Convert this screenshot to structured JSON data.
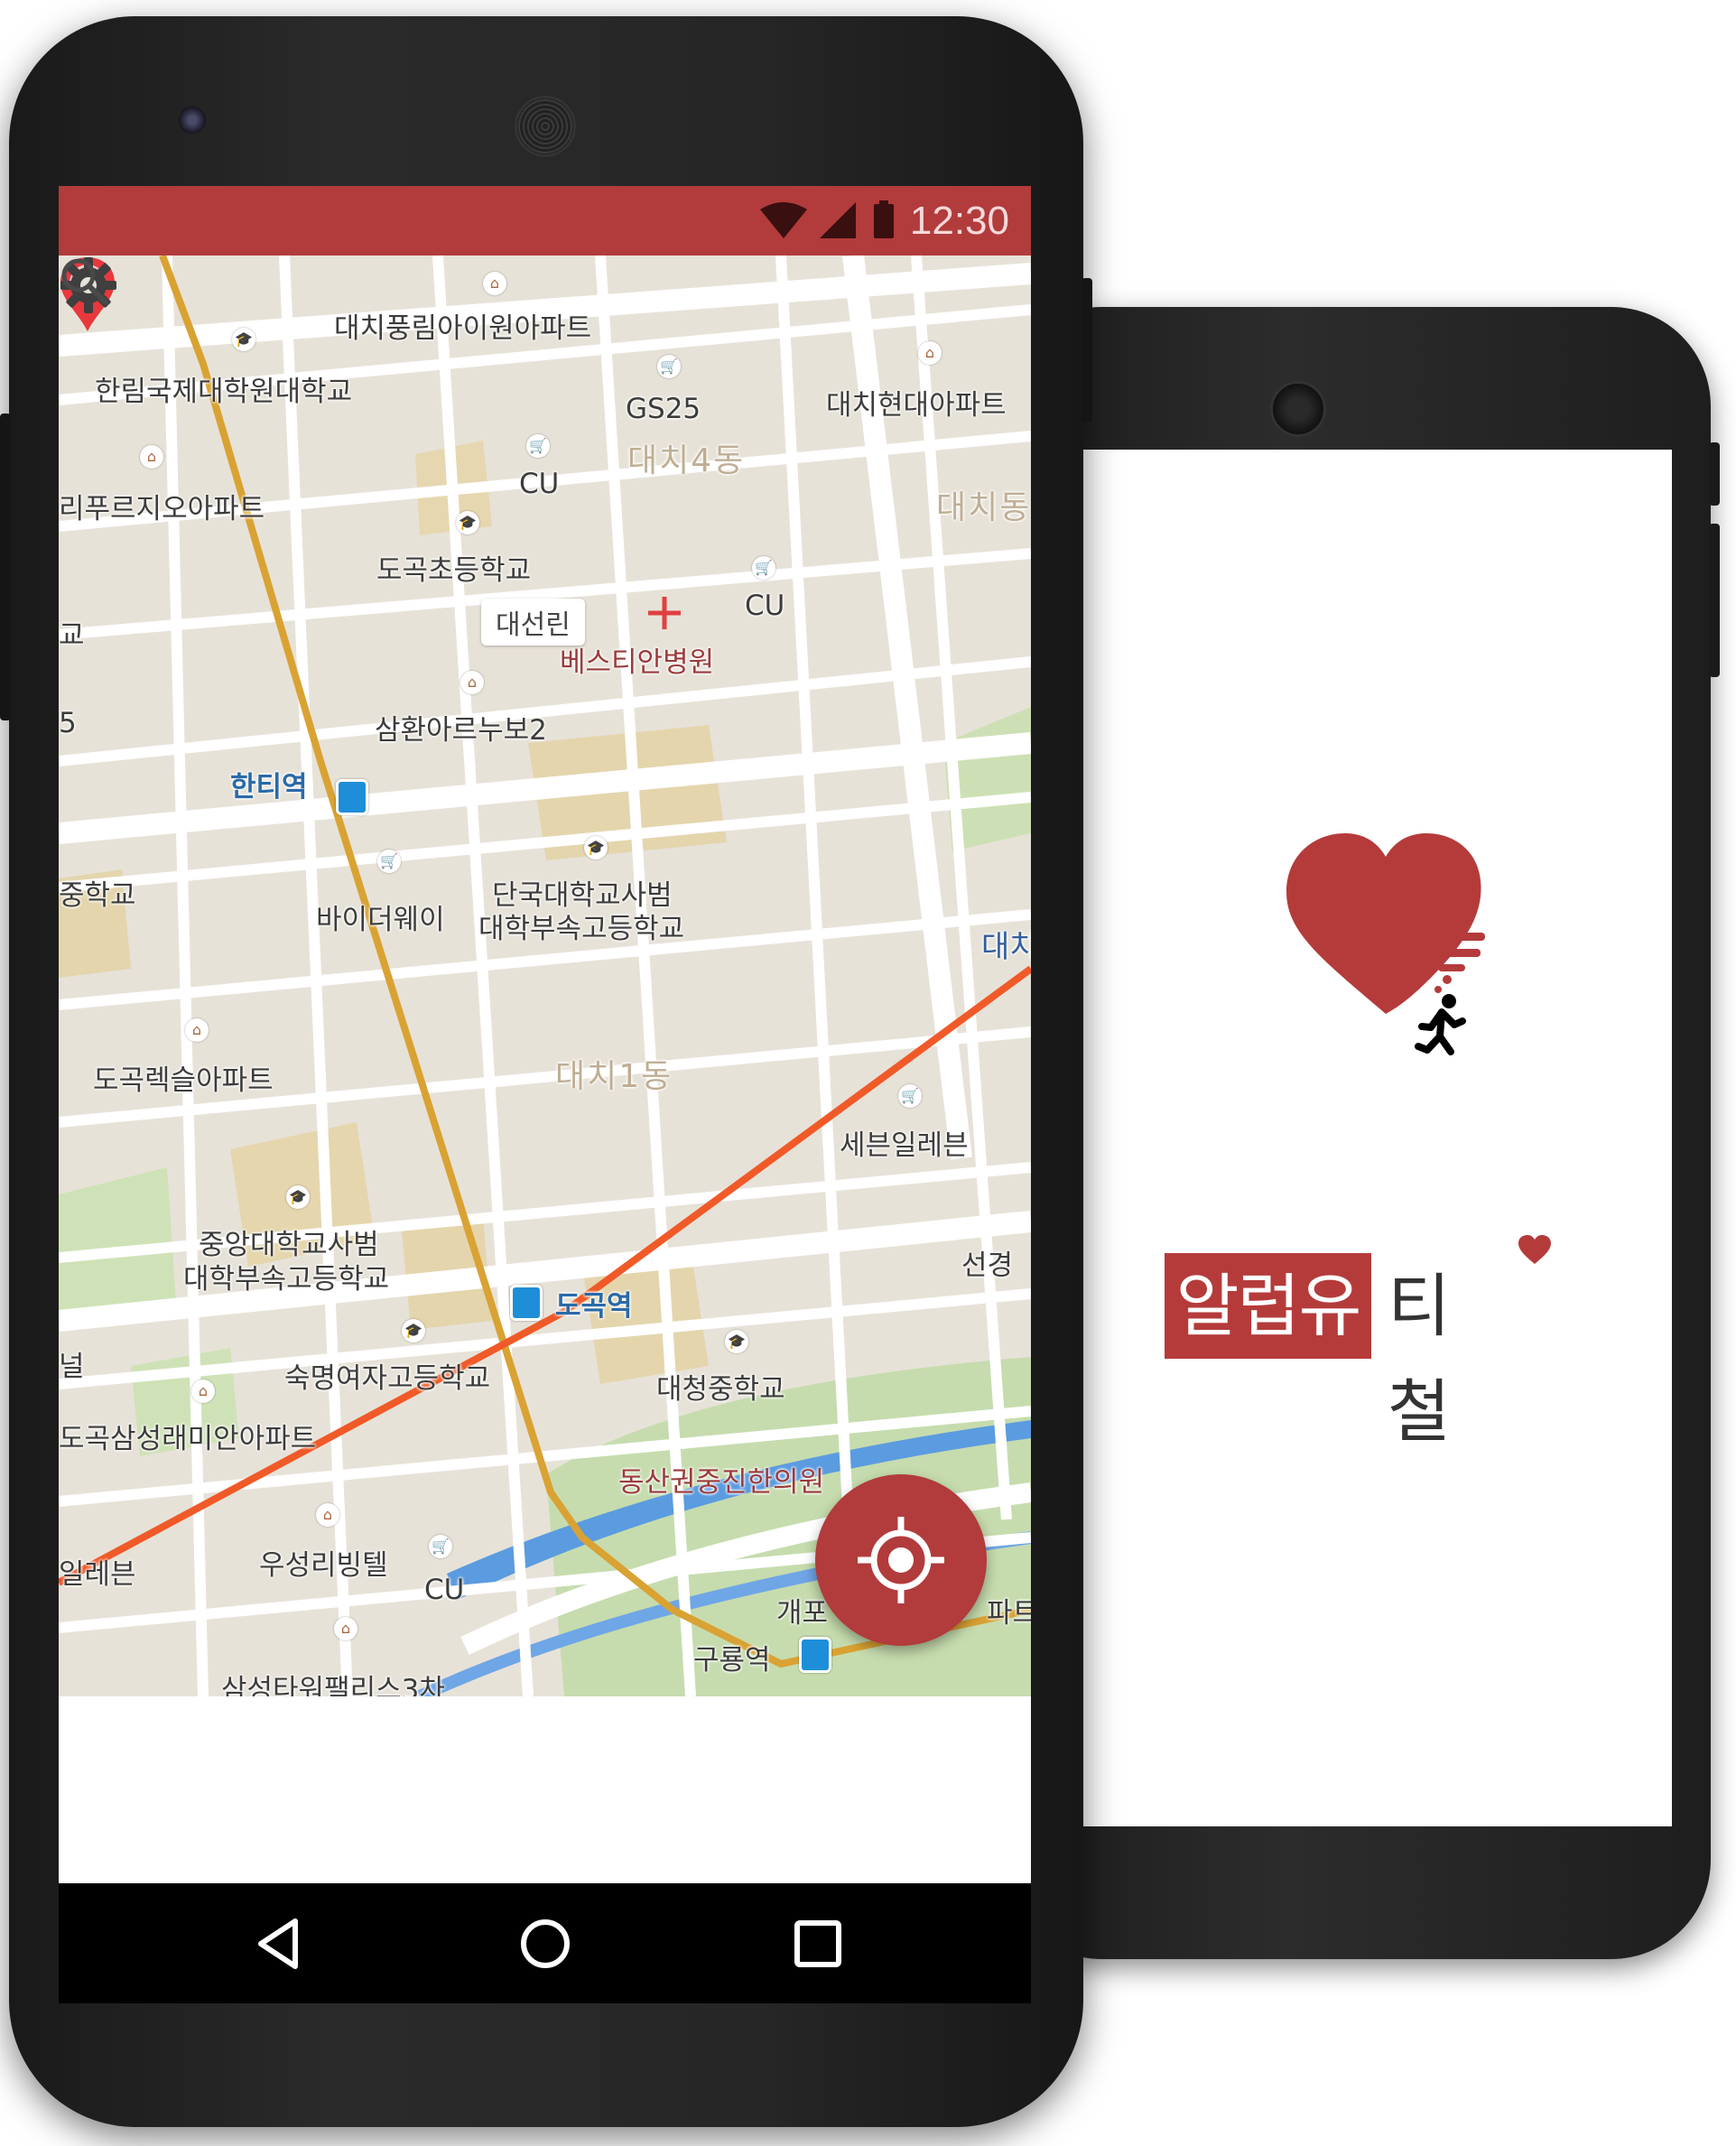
{
  "status_bar": {
    "time": "12:30"
  },
  "map": {
    "tooltip": "대선린",
    "labels": {
      "apt1": "대치풍림아이원아파트",
      "univ1": "한림국제대학원대학교",
      "gs25": "GS25",
      "daechi4": "대치4동",
      "daechihyun": "대치현대아파트",
      "cu1": "CU",
      "daechi_dong": "대치동",
      "ripurezio": "리푸르지오아파트",
      "dogok_elem": "도곡초등학교",
      "cu2": "CU",
      "hospital": "베스티안병원",
      "samhwan": "삼환아르누보2",
      "hanti": "한티역",
      "school_left": "중학교",
      "buyway": "바이더웨이",
      "dankook1": "단국대학교사범",
      "dankook2": "대학부속고등학교",
      "daechi_right": "대치",
      "dogok_rexle": "도곡렉슬아파트",
      "daechi1": "대치1동",
      "seven": "세븐일레븐",
      "chungang1": "중앙대학교사범",
      "chungang2": "대학부속고등학교",
      "seonkyung": "선경",
      "dogok_station": "도곡역",
      "sookmyung": "숙명여자고등학교",
      "daecheong": "대청중학교",
      "samsung_apt": "도곡삼성래미안아파트",
      "dongsan": "동산권중진한의원",
      "useong": "우성리빙텔",
      "cu3": "CU",
      "gaepo": "개포",
      "guryong": "구룡역",
      "samsung_tower": "삼성타워팰리스3차",
      "leven_left": "일레븐",
      "left_gyo": "교",
      "left_5": "5",
      "left_nul": "널",
      "apt_right": "파트"
    }
  },
  "splash": {
    "brand_highlight": "알럽유",
    "brand_rest": "티철",
    "accent_color": "#b53b3b"
  },
  "icons": {
    "settings": "gear-icon",
    "search": "search-icon",
    "locate": "crosshair-icon",
    "back": "back-triangle-icon",
    "home": "home-circle-icon",
    "recents": "recents-square-icon"
  }
}
